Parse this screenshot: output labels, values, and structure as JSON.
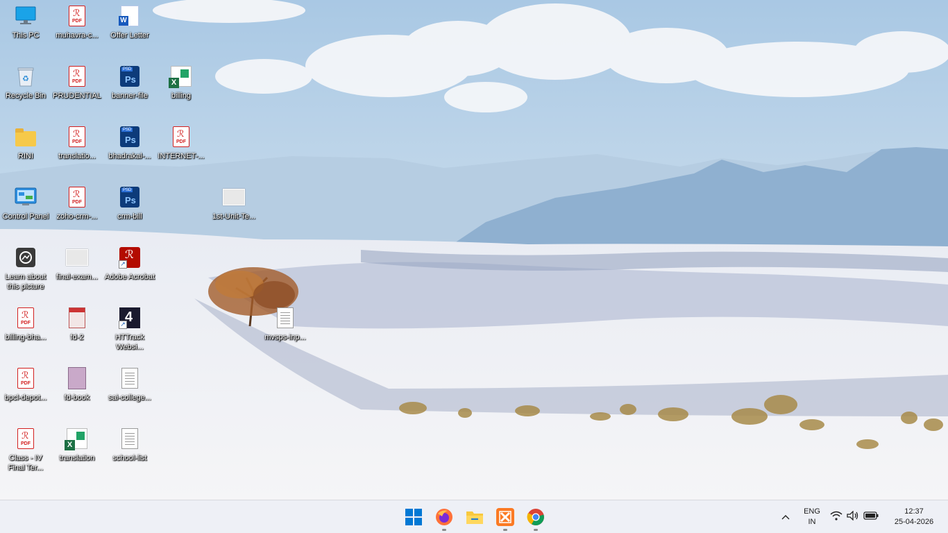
{
  "desktop": {
    "icons": [
      {
        "label": "This PC",
        "type": "monitor"
      },
      {
        "label": "muhavra-c...",
        "type": "pdf"
      },
      {
        "label": "Offer Letter",
        "type": "word"
      },
      {
        "label": "Recycle Bin",
        "type": "recycle"
      },
      {
        "label": "PRUDENTIAL",
        "type": "pdf"
      },
      {
        "label": "banner-file",
        "type": "psd"
      },
      {
        "label": "billing",
        "type": "xls"
      },
      {
        "label": "RINI",
        "type": "folder"
      },
      {
        "label": "translatio...",
        "type": "pdf"
      },
      {
        "label": "bhadrakal-...",
        "type": "psd"
      },
      {
        "label": "INTERNET-...",
        "type": "pdf"
      },
      {
        "label": "Control Panel",
        "type": "control"
      },
      {
        "label": "zoho-crm-...",
        "type": "pdf"
      },
      {
        "label": "crm-bill",
        "type": "psd"
      },
      {
        "label": "1st-Unit-Te...",
        "type": "thumb"
      },
      {
        "label": "Learn about this picture",
        "type": "learn"
      },
      {
        "label": "final-exam...",
        "type": "thumb"
      },
      {
        "label": "Adobe Acrobat",
        "type": "acrobat"
      },
      {
        "label": "billing-bha...",
        "type": "pdf"
      },
      {
        "label": "fd-2",
        "type": "book"
      },
      {
        "label": "HTTrack Websi...",
        "type": "httrack"
      },
      {
        "label": "mvsps-inp...",
        "type": "doc"
      },
      {
        "label": "bpcl-depot...",
        "type": "pdf"
      },
      {
        "label": "fd-book",
        "type": "book2"
      },
      {
        "label": "sai-college...",
        "type": "doc"
      },
      {
        "label": "Class - IV Final Ter...",
        "type": "pdf"
      },
      {
        "label": "translation",
        "type": "xls"
      },
      {
        "label": "school-list",
        "type": "doc"
      }
    ]
  },
  "taskbar": {
    "apps": [
      {
        "name": "start-button",
        "icon": "windows-icon"
      },
      {
        "name": "firefox-app",
        "icon": "firefox-icon"
      },
      {
        "name": "file-explorer-app",
        "icon": "folder-icon"
      },
      {
        "name": "xampp-app",
        "icon": "xampp-icon"
      },
      {
        "name": "chrome-app",
        "icon": "chrome-icon"
      }
    ],
    "tray": {
      "lang_top": "ENG",
      "lang_bottom": "IN",
      "time": "12:37",
      "date": "25-04-2026"
    }
  },
  "colors": {
    "taskbar_bg": "#eef0f6",
    "windows_blue": "#0078d4",
    "pdf_red": "#d21f1f"
  }
}
